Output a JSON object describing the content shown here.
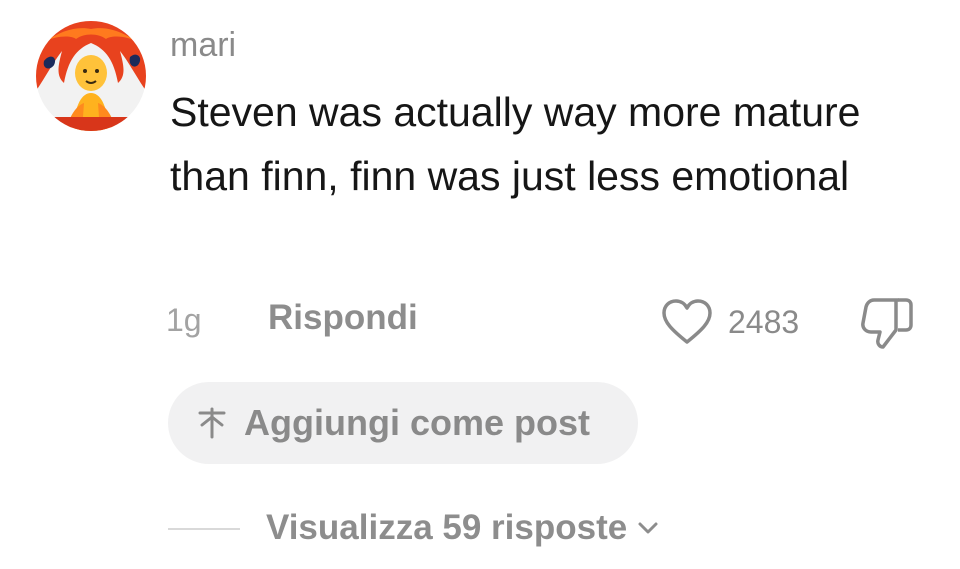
{
  "comment": {
    "username": "mari",
    "text": "Steven was actually way more mature than finn, finn was just less emotional",
    "time": "1g",
    "reply_label": "Rispondi",
    "like_count": "2483"
  },
  "add_post": {
    "label": "Aggiungi come post"
  },
  "replies": {
    "label": "Visualizza 59 risposte"
  },
  "icons": {
    "avatar": "flame-princess-avatar",
    "like": "heart-outline-icon",
    "dislike": "thumbs-down-icon",
    "add_post": "sparkle-pin-icon",
    "expand": "chevron-down-icon"
  },
  "colors": {
    "text_primary": "#161616",
    "text_secondary": "#8a8a8a",
    "pill_background": "#f1f1f2"
  }
}
